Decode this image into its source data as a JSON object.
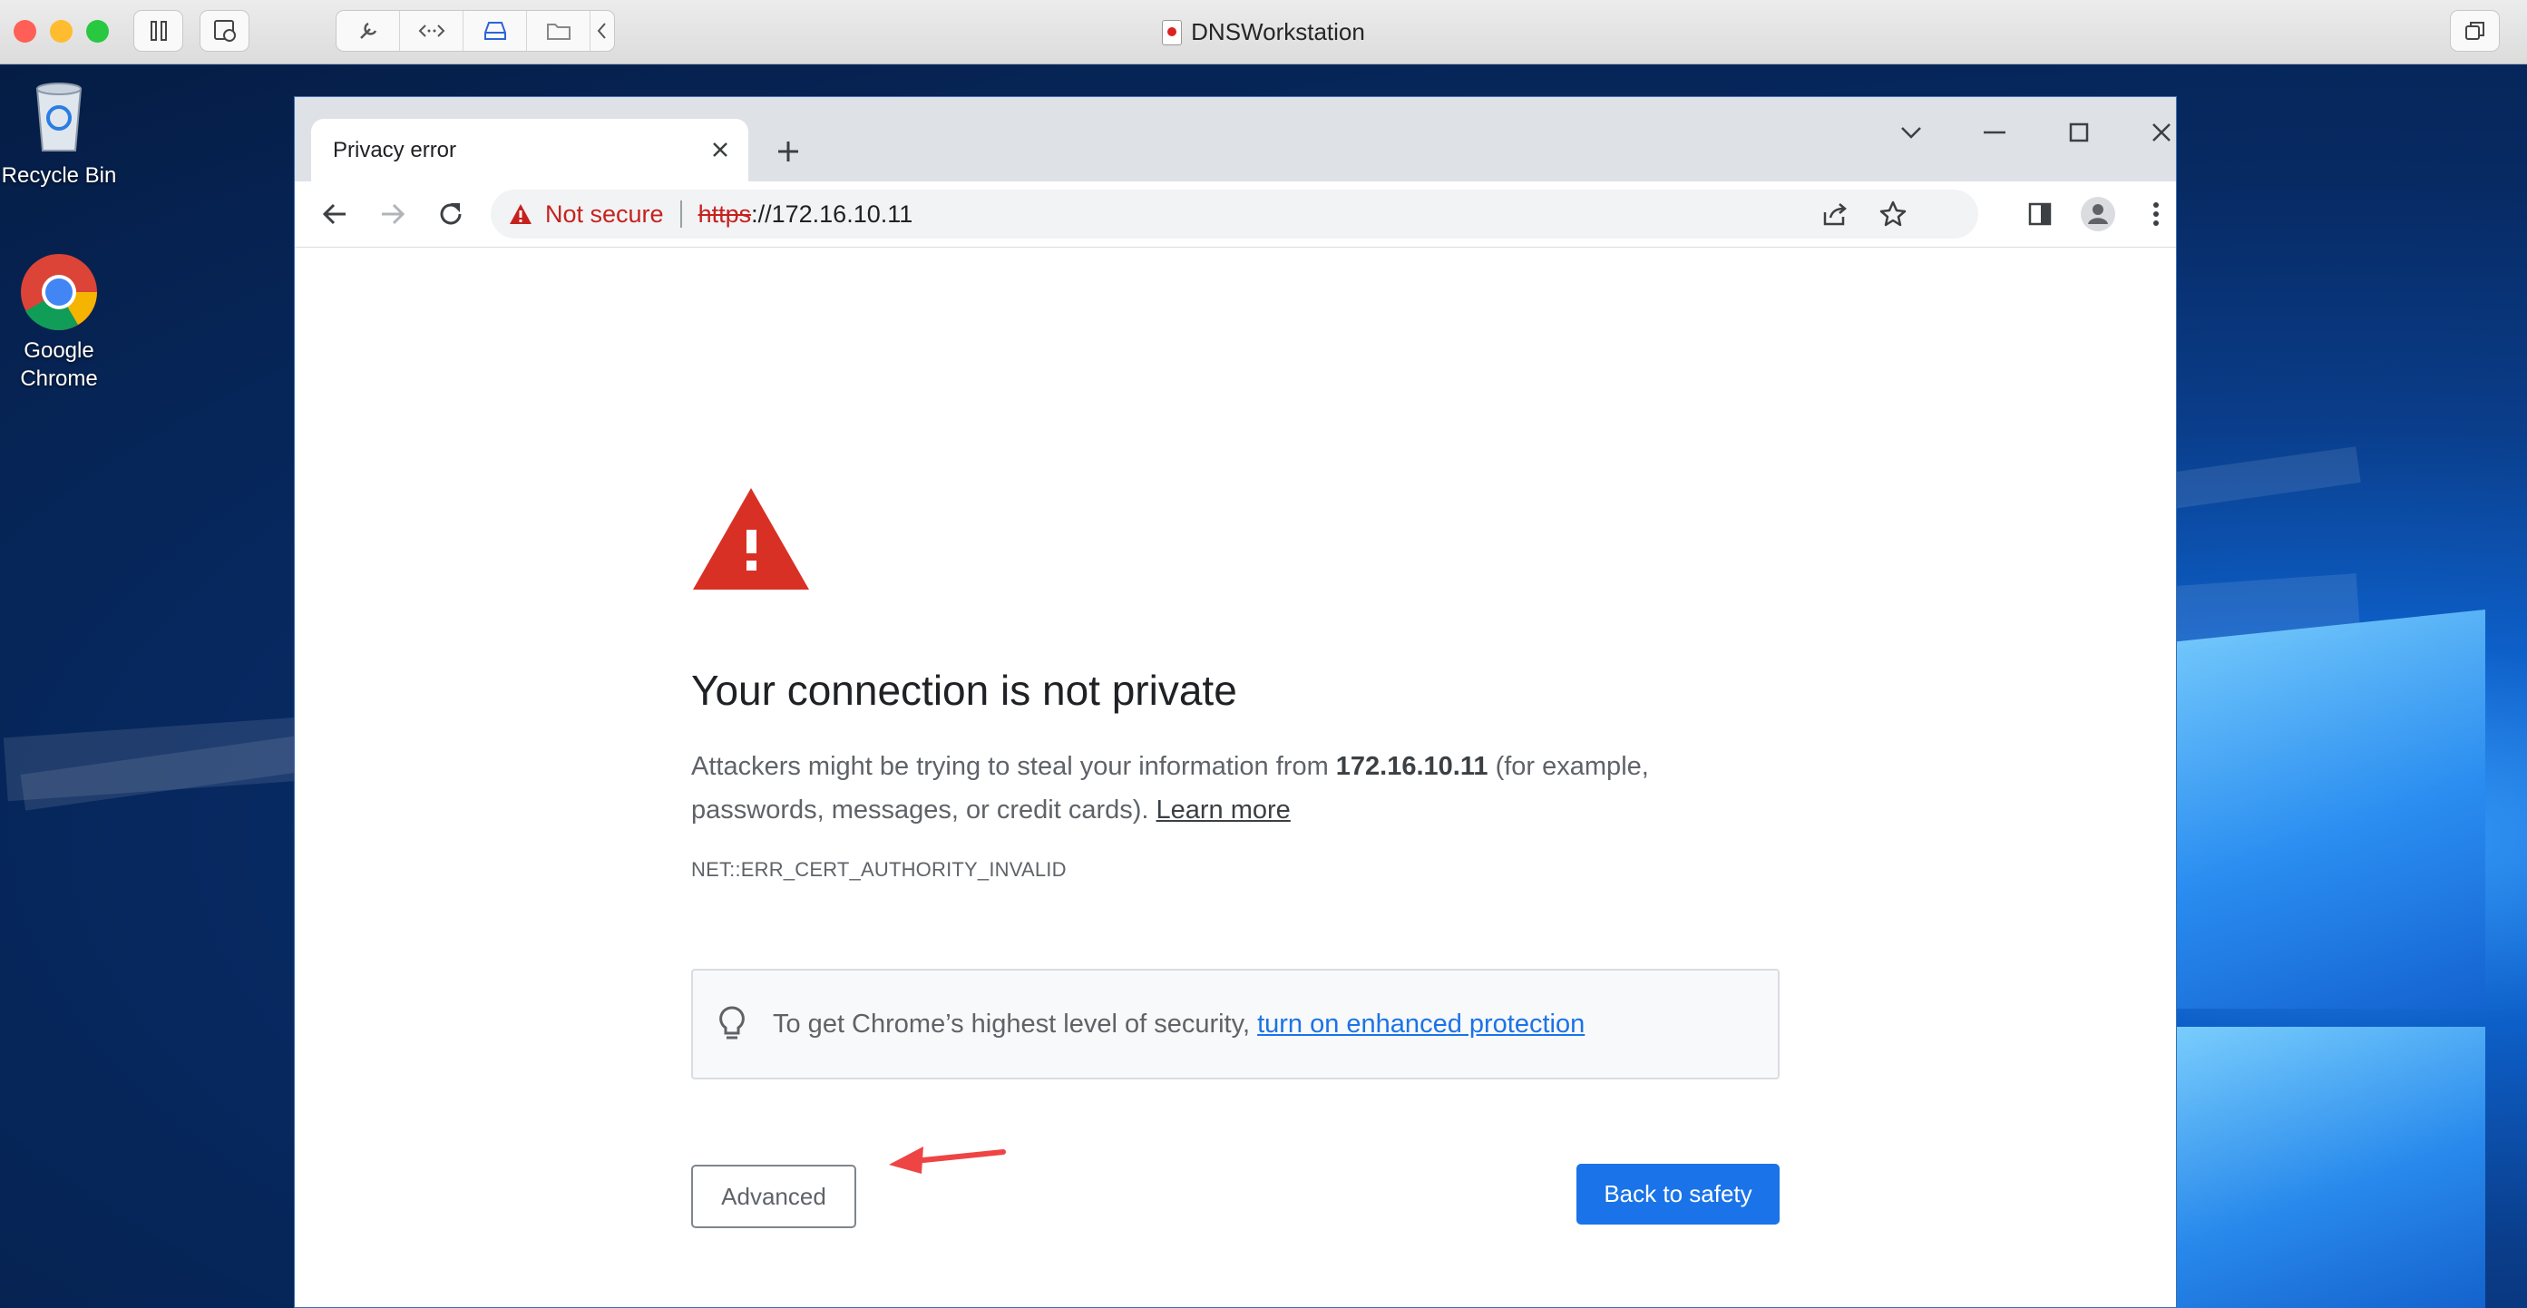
{
  "host": {
    "title": "DNSWorkstation",
    "traffic_lights": {
      "close": "#ff5f57",
      "minimize": "#febc2e",
      "zoom": "#28c840"
    }
  },
  "desktop": {
    "icons": [
      {
        "label": "Recycle Bin"
      },
      {
        "label": "Google Chrome"
      }
    ]
  },
  "browser": {
    "tab_title": "Privacy error",
    "security_chip": "Not secure",
    "url_scheme": "https",
    "url_rest": "://172.16.10.11"
  },
  "interstitial": {
    "heading": "Your connection is not private",
    "desc_prefix": "Attackers might be trying to steal your information from ",
    "desc_host": "172.16.10.11",
    "desc_suffix": " (for example, passwords, messages, or credit cards). ",
    "learn_more": "Learn more",
    "error_code": "NET::ERR_CERT_AUTHORITY_INVALID",
    "enhanced_text": "To get Chrome’s highest level of security, ",
    "enhanced_link": "turn on enhanced protection",
    "advanced_label": "Advanced",
    "back_label": "Back to safety"
  },
  "colors": {
    "warning_red": "#d93025",
    "accent_blue": "#1a73e8",
    "annotation_arrow": "#ef4444"
  }
}
